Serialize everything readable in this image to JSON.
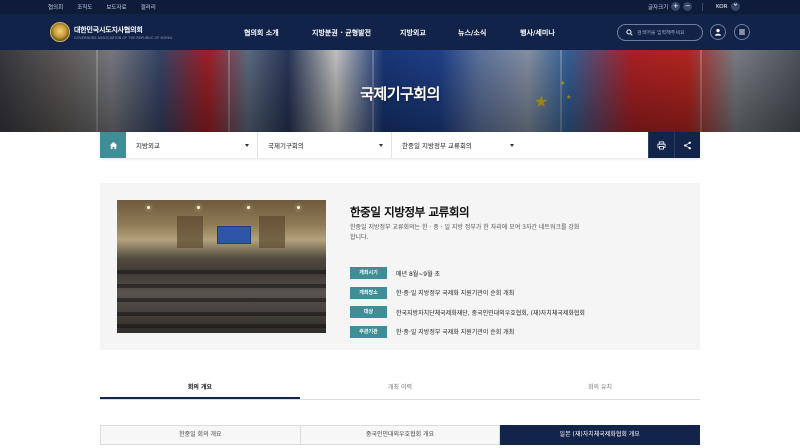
{
  "util_bar": {
    "links": [
      "협의회",
      "조직도",
      "보도자료",
      "갤러리"
    ],
    "font_size_label": "글자크기",
    "font_plus": "+",
    "font_minus": "−",
    "language": "KOR",
    "language_chevron": "chevron-down-icon"
  },
  "header": {
    "logo_name": "대한민국시도지사협의회",
    "logo_sub": "GOVERNORS ASSOCIATION OF THE REPUBLIC OF KOREA",
    "logo_icon": "seal-icon",
    "menu": [
      "협의회 소개",
      "지방분권 · 균형발전",
      "지방외교",
      "뉴스/소식",
      "행사/세미나"
    ],
    "search_placeholder": "검색어를 입력해주세요",
    "search_icon": "search-icon",
    "user_icon": "user-icon",
    "menu_icon": "hamburger-icon"
  },
  "hero": {
    "title": "국제기구회의"
  },
  "location": {
    "home_icon": "home-icon",
    "depth1": "지방외교",
    "depth2": "국제기구회의",
    "depth3": "한중일 지방정부 교류회의",
    "print_icon": "print-icon",
    "share_icon": "share-icon"
  },
  "card": {
    "title": "한중일 지방정부 교류회의",
    "description": "한중일 지방정부 교류회의는 한 · 중 · 일 지방 정부가 한 자리에 모여 3자간 네트워크를 강화합니다.",
    "rows": [
      {
        "label": "개최시기",
        "value": "매년 8월~9월 초"
      },
      {
        "label": "개최장소",
        "value": "한·중·일 지방정부 국제화 지원기관이 순회 개최"
      },
      {
        "label": "대상",
        "value": "한국지방자치단체국제화재단, 중국인민대외우호협회, (재)자치체국제화협회"
      },
      {
        "label": "주관기관",
        "value": "한·중·일 지방정부 국제화 지원기관이 순회 개최"
      }
    ]
  },
  "tabs": [
    {
      "label": "회의 개요",
      "active": true
    },
    {
      "label": "개최 이력",
      "active": false
    },
    {
      "label": "회의 유치",
      "active": false
    }
  ],
  "subtabs": [
    {
      "label": "한중일 회의 개요",
      "active": false
    },
    {
      "label": "중국인민대외우호협회 개요",
      "active": false
    },
    {
      "label": "일본 (재)자치체국제화협회 개요",
      "active": true
    }
  ],
  "colors": {
    "navy": "#13244b",
    "teal": "#3f8d95",
    "card_bg": "#f5f5f5"
  }
}
